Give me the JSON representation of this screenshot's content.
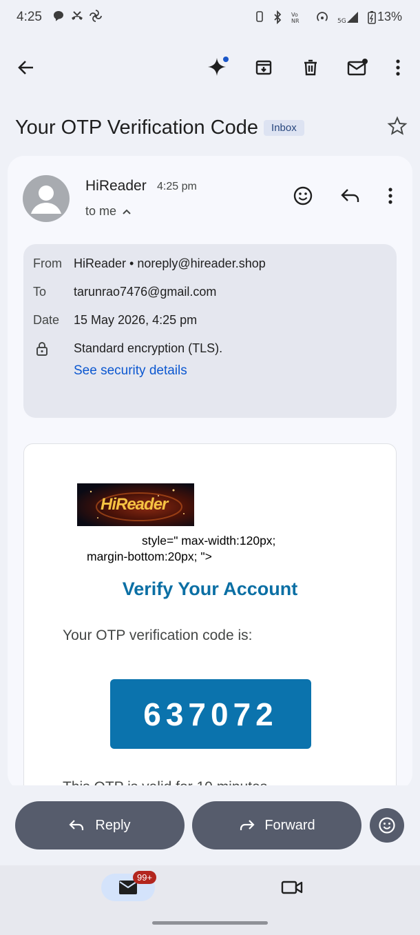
{
  "status_bar": {
    "time": "4:25",
    "battery": "13%",
    "network_label": "5G",
    "left_icons": [
      "chat-bubble-icon",
      "missed-call-icon",
      "pinwheel-icon"
    ],
    "right_icons": [
      "vibrate-icon",
      "bluetooth-icon",
      "vonr-icon",
      "hotspot-icon",
      "signal-icon",
      "battery-icon"
    ]
  },
  "toolbar": {
    "icons": [
      "back-arrow-icon",
      "gemini-sparkle-icon",
      "archive-icon",
      "delete-icon",
      "mark-unread-icon",
      "more-vert-icon"
    ]
  },
  "email": {
    "subject": "Your OTP Verification Code",
    "label": "Inbox",
    "sender_name": "HiReader",
    "time": "4:25 pm",
    "to_me": "to me",
    "details": {
      "from_label": "From",
      "from_value": "HiReader • noreply@hireader.shop",
      "to_label": "To",
      "to_value": "tarunrao7476@gmail.com",
      "date_label": "Date",
      "date_value": "15 May 2026, 4:25 pm",
      "encryption": "Standard encryption (TLS).",
      "security_link": "See security details"
    },
    "body": {
      "logo_text": "HiReader",
      "stray_line1": "style=\" max-width:120px;",
      "stray_line2": "margin-bottom:20px; \">",
      "heading": "Verify Your Account",
      "intro": "Your OTP verification code is:",
      "otp": "637072",
      "valid_text": "This OTP is valid for 10 minutes."
    }
  },
  "actions": {
    "reply": "Reply",
    "forward": "Forward"
  },
  "bottom_nav": {
    "mail_badge": "99+"
  },
  "colors": {
    "accent_blue": "#0b6fa4",
    "otp_box": "#0b73ad",
    "link": "#0b57d0",
    "pill": "#565c6c",
    "badge_red": "#b3261e"
  }
}
